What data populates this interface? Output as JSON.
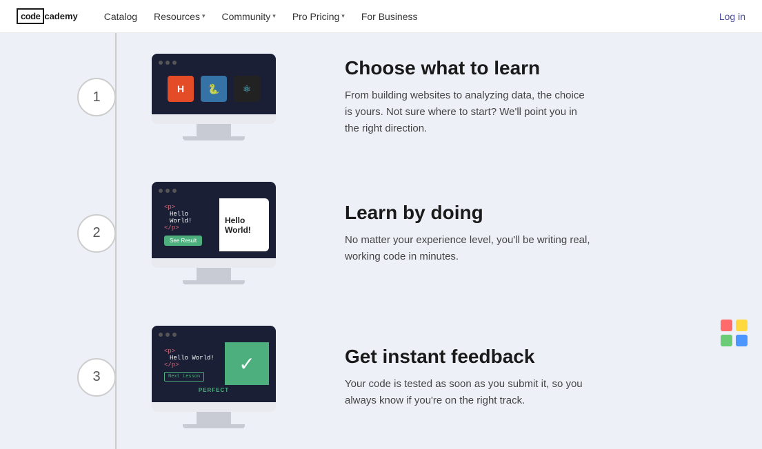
{
  "nav": {
    "logo_code": "code",
    "logo_academy": "cademy",
    "links": [
      {
        "label": "Catalog",
        "has_dropdown": false
      },
      {
        "label": "Resources",
        "has_dropdown": true
      },
      {
        "label": "Community",
        "has_dropdown": true
      },
      {
        "label": "Pro Pricing",
        "has_dropdown": true
      },
      {
        "label": "For Business",
        "has_dropdown": false
      }
    ],
    "login_label": "Log in"
  },
  "steps": [
    {
      "number": "1",
      "title": "Choose what to learn",
      "description": "From building websites to analyzing data, the choice is yours. Not sure where to start? We'll point you in the right direction."
    },
    {
      "number": "2",
      "title": "Learn by doing",
      "description": "No matter your experience level, you'll be writing real, working code in minutes."
    },
    {
      "number": "3",
      "title": "Get instant feedback",
      "description": "Your code is tested as soon as you submit it, so you always know if you're on the right track."
    }
  ],
  "step2": {
    "code_line1": "<p>",
    "code_line2": "Hello World!",
    "code_line3": "</p>",
    "hello_world": "Hello World!",
    "see_result": "See Result"
  },
  "step3": {
    "code_line1": "<p>",
    "code_line2": "Hello World!",
    "code_line3": "</p>",
    "next_lesson": "Next Lesson",
    "perfect": "PERFECT"
  },
  "logo_colors": {
    "top_left": "#ff6b6b",
    "top_right": "#ffd93d",
    "bottom_left": "#6bcb77",
    "bottom_right": "#4d96ff"
  }
}
